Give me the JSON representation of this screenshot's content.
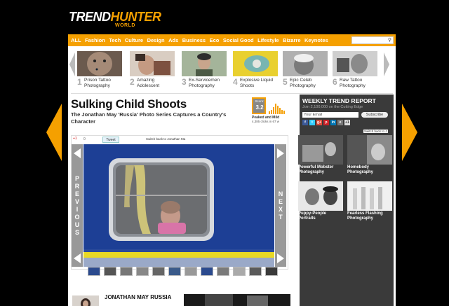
{
  "logo": {
    "part1": "TREND",
    "part2": "HUNTER",
    "sub": "WORLD"
  },
  "nav": [
    "ALL",
    "Fashion",
    "Tech",
    "Culture",
    "Design",
    "Ads",
    "Business",
    "Eco",
    "Social Good",
    "Lifestyle",
    "Bizarre",
    "Keynotes"
  ],
  "trending": [
    {
      "num": "1",
      "label": "Prison Tattoo Photography"
    },
    {
      "num": "2",
      "label": "Amazing Adolescent"
    },
    {
      "num": "3",
      "label": "Ex-Servicemen Photography"
    },
    {
      "num": "4",
      "label": "Explosive Liquid Shoots"
    },
    {
      "num": "5",
      "label": "Epic Celeb Photography"
    },
    {
      "num": "6",
      "label": "Raw Tattoo Photography"
    }
  ],
  "article": {
    "title": "Sulking Child Shoots",
    "subtitle": "The Jonathan May 'Russia' Photo Series Captures a Country's Character"
  },
  "score": {
    "label": "Score:",
    "value": "3.2",
    "status": "Peaked and Mild",
    "clicks": "4,385 clicks in 67 w"
  },
  "gallery": {
    "gplus": "+1",
    "count": "0",
    "tweet": "Tweet",
    "switch_tip": "Switch back to Jonathan Ma",
    "prev": [
      "P",
      "R",
      "E",
      "V",
      "I",
      "O",
      "U",
      "S"
    ],
    "next": [
      "N",
      "E",
      "X",
      "T"
    ]
  },
  "author": {
    "name": "JONATHAN MAY RUSSIA"
  },
  "sidebar": {
    "title": "WEEKLY TREND REPORT",
    "subtitle": "Join 2,100,000 on the Cutting Edge",
    "email_placeholder": "Your Email",
    "subscribe": "Subscribe",
    "switch_tip": "Switch back to J",
    "social": [
      "f",
      "t",
      "g+",
      "p",
      "in",
      "e",
      "+1"
    ],
    "cards": [
      {
        "label": "Powerful Mobster Photography"
      },
      {
        "label": "Homebody Photography"
      },
      {
        "label": "Puppy-People Portraits"
      },
      {
        "label": "Fearless Flashing Photography"
      }
    ]
  },
  "colors": {
    "accent": "#f5a000",
    "sidebar": "#3a3a3a",
    "frame": "#ffffff"
  }
}
